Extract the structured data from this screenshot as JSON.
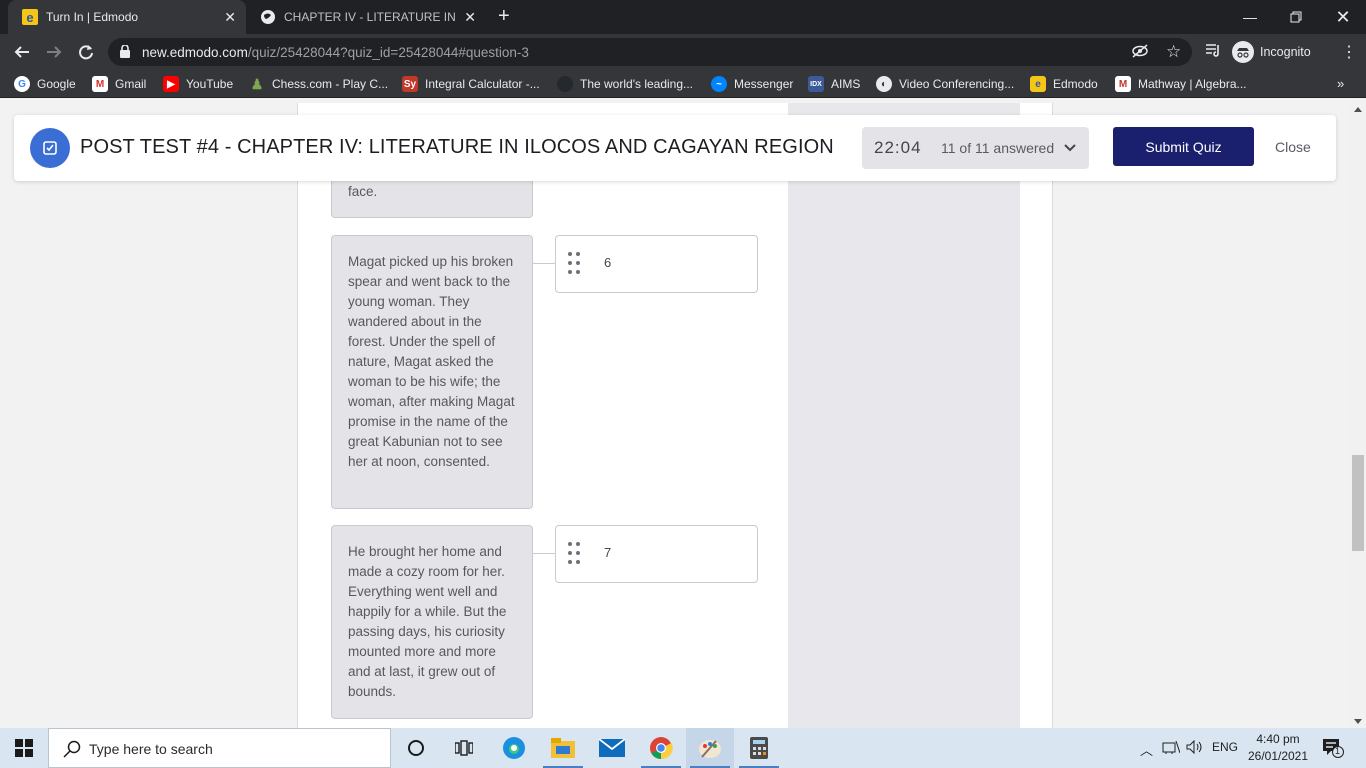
{
  "browser": {
    "tabs": [
      {
        "title": "Turn In | Edmodo",
        "active": true,
        "favicon": "edmodo-icon"
      },
      {
        "title": "CHAPTER IV - LITERATURE IN ILO",
        "active": false,
        "favicon": "globe-icon"
      }
    ],
    "url_host": "new.edmodo.com",
    "url_path": "/quiz/25428044?quiz_id=25428044#question-3",
    "profile_label": "Incognito",
    "bookmarks": [
      {
        "label": "Google",
        "icon": "google-icon",
        "color": "#4285f4"
      },
      {
        "label": "Gmail",
        "icon": "gmail-icon",
        "color": "#d93025"
      },
      {
        "label": "YouTube",
        "icon": "youtube-icon",
        "color": "#ff0000"
      },
      {
        "label": "Chess.com - Play C...",
        "icon": "chess-icon",
        "color": "#7fa650"
      },
      {
        "label": "Integral Calculator -...",
        "icon": "sy-icon",
        "color": "#c0392b"
      },
      {
        "label": "The world's leading...",
        "icon": "github-icon",
        "color": "#24292e"
      },
      {
        "label": "Messenger",
        "icon": "messenger-icon",
        "color": "#0084ff"
      },
      {
        "label": "AIMS",
        "icon": "aims-icon",
        "color": "#3d5a98"
      },
      {
        "label": "Video Conferencing...",
        "icon": "globe-icon",
        "color": "#9aa0a6"
      },
      {
        "label": "Edmodo",
        "icon": "edmodo-icon",
        "color": "#f5c518"
      },
      {
        "label": "Mathway | Algebra...",
        "icon": "mathway-icon",
        "color": "#c0392b"
      }
    ]
  },
  "quiz": {
    "title": "POST TEST #4 - CHAPTER IV: LITERATURE IN ILOCOS AND CAGAYAN REGION",
    "timer": "22:04",
    "answered": "11 of 11 answered",
    "submit_label": "Submit Quiz",
    "close_label": "Close",
    "accent": "#1a1f6e",
    "top_card_tail": "face.",
    "matches": [
      {
        "text": "Magat picked up his broken spear and went back to the young woman. They wandered about in the forest. Under the spell of nature, Magat asked the woman to be his wife; the woman, after making Magat promise in the name of the great Kabunian not to see her at noon, consented.",
        "answer": "6"
      },
      {
        "text": "He brought her home and made a cozy room for her. Everything went well and happily for a while. But the passing days, his curiosity mounted more and more and at last, it grew out of bounds.",
        "answer": "7"
      }
    ]
  },
  "taskbar": {
    "search_placeholder": "Type here to search",
    "language": "ENG",
    "time": "4:40 pm",
    "date": "26/01/2021",
    "notification_count": "1"
  }
}
